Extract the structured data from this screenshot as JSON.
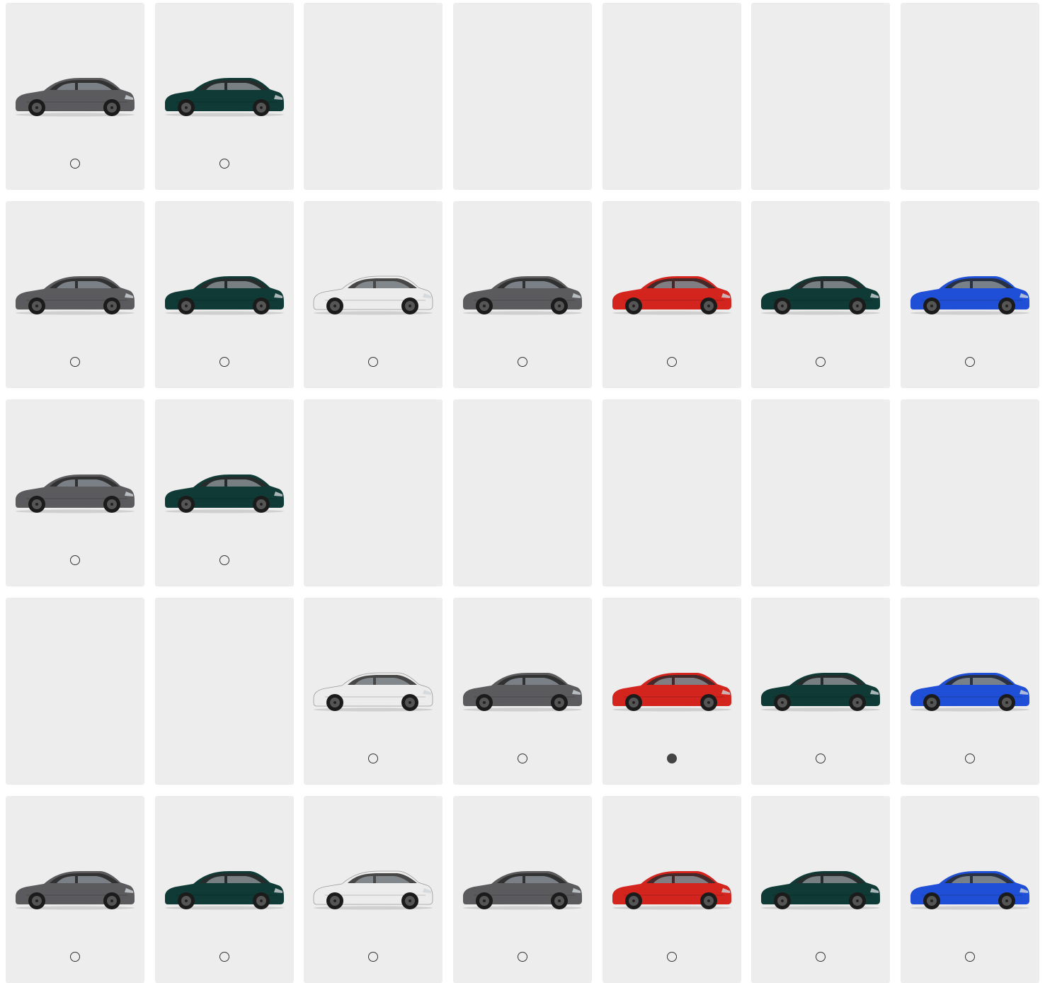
{
  "rows": [
    [
      "#5b5b5e",
      "#0f3a36",
      null,
      null,
      null,
      null,
      null
    ],
    [
      "#5b5b5e",
      "#0f3a36",
      "#ececec",
      "#5b5b5e",
      "#d4241e",
      "#0f3a36",
      "#1f4fd6"
    ],
    [
      "#5b5b5e",
      "#0f3a36",
      null,
      null,
      null,
      null,
      null
    ],
    [
      null,
      null,
      "#ececec",
      "#5b5b5e",
      "#d4241e",
      "#0f3a36",
      "#1f4fd6"
    ],
    [
      "#5b5b5e",
      "#0f3a36",
      "#ececec",
      "#5b5b5e",
      "#d4241e",
      "#0f3a36",
      "#1f4fd6"
    ]
  ],
  "selected": {
    "row": 3,
    "col": 4
  },
  "roof_color": "#2a2a2a",
  "icons": {
    "car": "car-side-icon",
    "radio": "radio-option"
  }
}
